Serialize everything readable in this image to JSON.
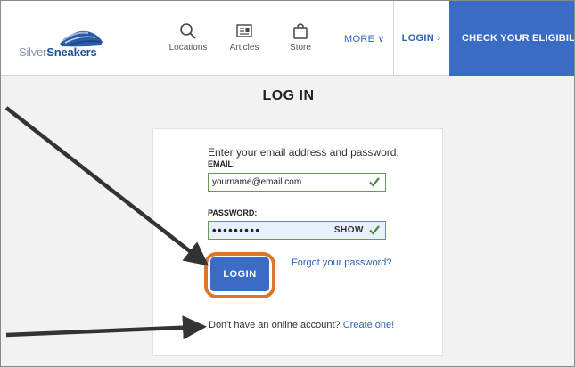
{
  "header": {
    "logo": {
      "silver": "Silver",
      "sneakers": "Sneakers"
    },
    "nav": [
      {
        "label": "Locations",
        "icon": "search-icon"
      },
      {
        "label": "Articles",
        "icon": "newspaper-icon"
      },
      {
        "label": "Store",
        "icon": "shopping-bag-icon"
      }
    ],
    "more": "MORE ∨",
    "login": "LOGIN ›",
    "eligibility": "CHECK YOUR ELIGIBILITY ›"
  },
  "page": {
    "title": "LOG IN"
  },
  "form": {
    "instructions": "Enter your email address and password.",
    "email_label": "EMAIL:",
    "email_value": "yourname@email.com",
    "password_label": "PASSWORD:",
    "password_value": "•••••••••",
    "show_label": "SHOW",
    "login_button": "LOGIN",
    "forgot_link": "Forgot your password?",
    "signup_text": "Don't have an online account?",
    "signup_link": "Create one!"
  },
  "colors": {
    "brand_blue": "#3a6cc6",
    "link_blue": "#2f63b8",
    "highlight_orange": "#d9772e",
    "valid_green": "#4a8a32"
  }
}
